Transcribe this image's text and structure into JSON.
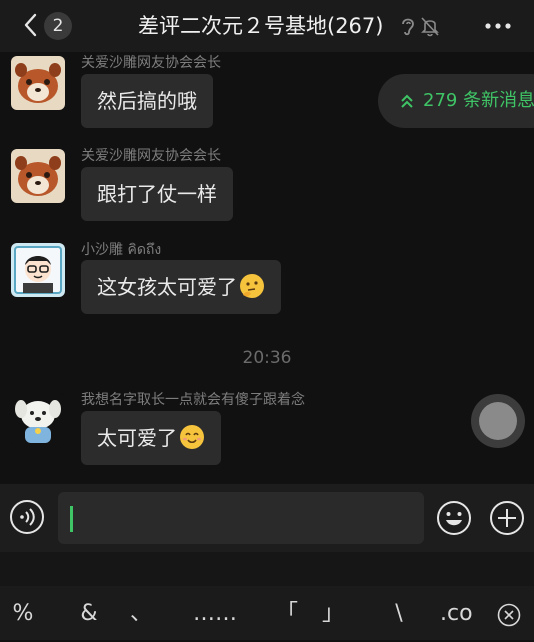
{
  "header": {
    "unread_count": "2",
    "title": "差评二次元２号基地(267)"
  },
  "new_messages": {
    "label": "279 条新消息"
  },
  "messages": [
    {
      "sender": "关爱沙雕网友协会会长",
      "text": "然后搞的哦",
      "avatar": "red-panda-avatar"
    },
    {
      "sender": "关爱沙雕网友协会会长",
      "text": "跟打了仗一样",
      "avatar": "red-panda-avatar"
    },
    {
      "sender": "小沙雕 คิดถึง",
      "text": "这女孩太可爱了",
      "avatar": "cartoon-boy-avatar",
      "emoji": "thinking-emoji"
    },
    {
      "sender": "我想名字取长一点就会有傻子跟着念",
      "text": "太可爱了",
      "avatar": "white-dog-avatar",
      "emoji": "smile-emoji"
    }
  ],
  "timestamp": "20:36",
  "input": {
    "value": ""
  },
  "keyboard": {
    "keys": [
      "%",
      "&",
      "、",
      "……",
      "「",
      "」",
      "\\",
      ".co"
    ]
  },
  "colors": {
    "accent_green": "#3fc466",
    "background": "#111111",
    "bubble": "#2c2c2c"
  }
}
